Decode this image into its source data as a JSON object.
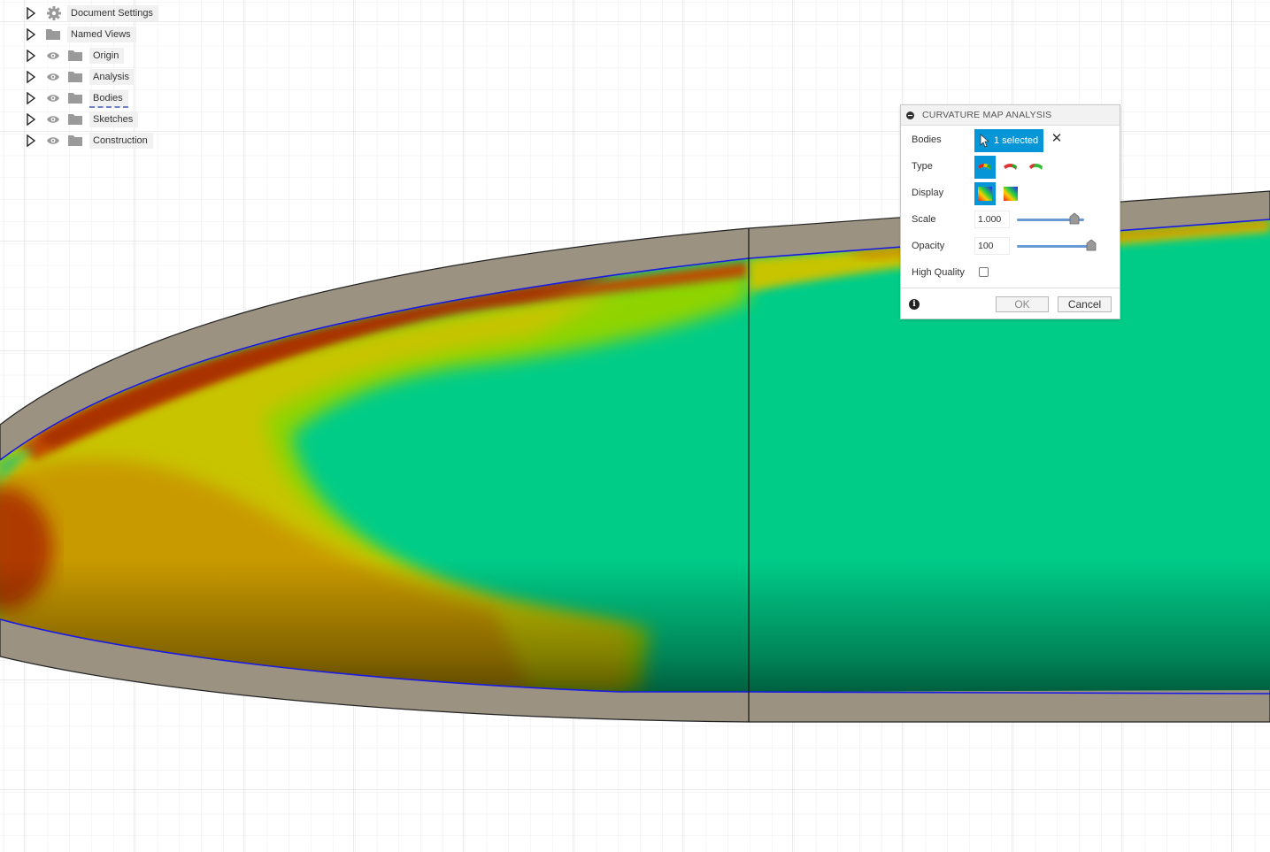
{
  "browser": {
    "items": [
      {
        "label": "Document Settings",
        "icon": "gear-icon",
        "visibility": false
      },
      {
        "label": "Named Views",
        "icon": "folder-icon",
        "visibility": false
      },
      {
        "label": "Origin",
        "icon": "folder-icon",
        "visibility": true
      },
      {
        "label": "Analysis",
        "icon": "folder-icon",
        "visibility": true
      },
      {
        "label": "Bodies",
        "icon": "folder-icon",
        "visibility": true
      },
      {
        "label": "Sketches",
        "icon": "folder-icon",
        "visibility": true
      },
      {
        "label": "Construction",
        "icon": "folder-icon",
        "visibility": true
      }
    ]
  },
  "dialog": {
    "title": "CURVATURE MAP ANALYSIS",
    "bodies_label": "Bodies",
    "bodies_value": "1 selected",
    "type_label": "Type",
    "display_label": "Display",
    "scale_label": "Scale",
    "scale_value": "1.000",
    "scale_slider": 0.85,
    "opacity_label": "Opacity",
    "opacity_value": "100",
    "opacity_slider": 1.0,
    "high_quality_label": "High Quality",
    "high_quality_checked": false,
    "ok_label": "OK",
    "cancel_label": "Cancel"
  },
  "colors": {
    "accent": "#0696d7",
    "shell": "#9c9282",
    "edge_line": "#1a1ae6",
    "map_green": "#00cc88",
    "map_yellow": "#c8c800",
    "map_red": "#b83000",
    "grid": "#d8d8d8"
  }
}
